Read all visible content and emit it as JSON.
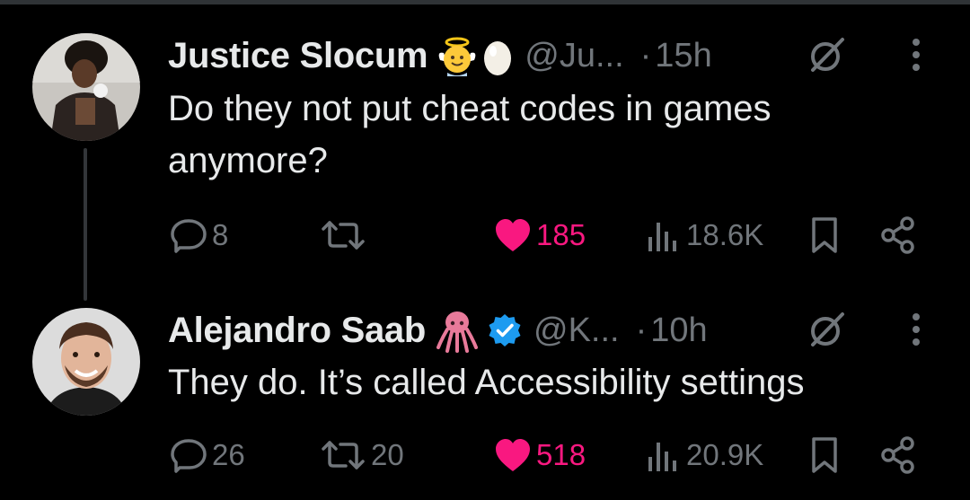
{
  "tweets": [
    {
      "author_name": "Justice Slocum",
      "badges": [
        "angel-emoji",
        "egg-emoji"
      ],
      "handle": "@Ju...",
      "dot": "·",
      "time": "15h",
      "text": "Do they not put cheat codes in games anymore?",
      "actions": {
        "replies": "8",
        "reposts": "",
        "likes": "185",
        "views": "18.6K"
      },
      "liked": true
    },
    {
      "author_name": "Alejandro Saab",
      "badges": [
        "octopus-emoji",
        "verified-badge"
      ],
      "handle": "@K...",
      "dot": "·",
      "time": "10h",
      "text": "They do. It’s called Accessibility settings",
      "actions": {
        "replies": "26",
        "reposts": "20",
        "likes": "518",
        "views": "20.9K"
      },
      "liked": true
    }
  ],
  "colors": {
    "background": "#000000",
    "text": "#e7e9ea",
    "muted": "#71767b",
    "like": "#f91880",
    "verified": "#1d9bf0",
    "thread_line": "#333639"
  },
  "icons": [
    "grok-icon",
    "more-icon",
    "reply-icon",
    "repost-icon",
    "heart-icon",
    "views-icon",
    "bookmark-icon",
    "share-icon"
  ]
}
